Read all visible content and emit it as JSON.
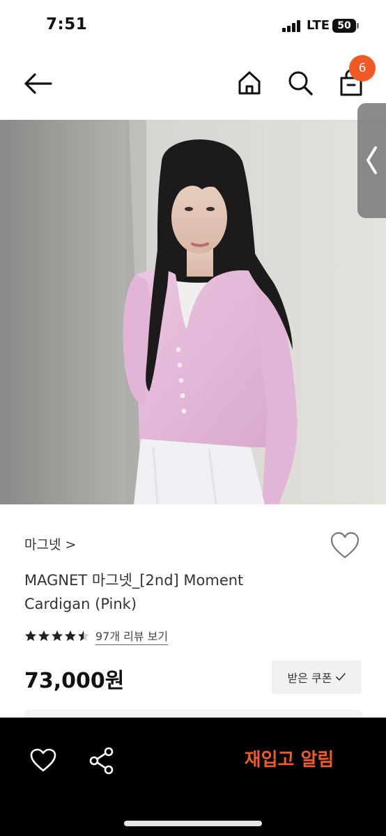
{
  "status_bar": {
    "time": "7:51",
    "network": "LTE",
    "battery": "50"
  },
  "nav": {
    "back_icon": "back-arrow-icon",
    "home_icon": "home-icon",
    "search_icon": "search-icon",
    "cart_icon": "shopping-bag-icon",
    "cart_count": "6"
  },
  "product": {
    "image_description_icon": "product-photo",
    "brand": "마그넷 >",
    "title_line1": "MAGNET 마그넷_[2nd] Moment",
    "title_line2": "Cardigan (Pink)",
    "rating": 4.5,
    "rating_max": 5,
    "review_link": "97개 리뷰 보기",
    "price": "73,000원",
    "coupon_label": "받은 쿠폰"
  },
  "bottom_bar": {
    "wishlist_icon": "heart-icon",
    "share_icon": "share-icon",
    "restock_label": "재입고 알림"
  },
  "colors": {
    "accent": "#f15a24",
    "bottom_bar": "#000000",
    "cardigan_pink": "#e7bddc"
  }
}
